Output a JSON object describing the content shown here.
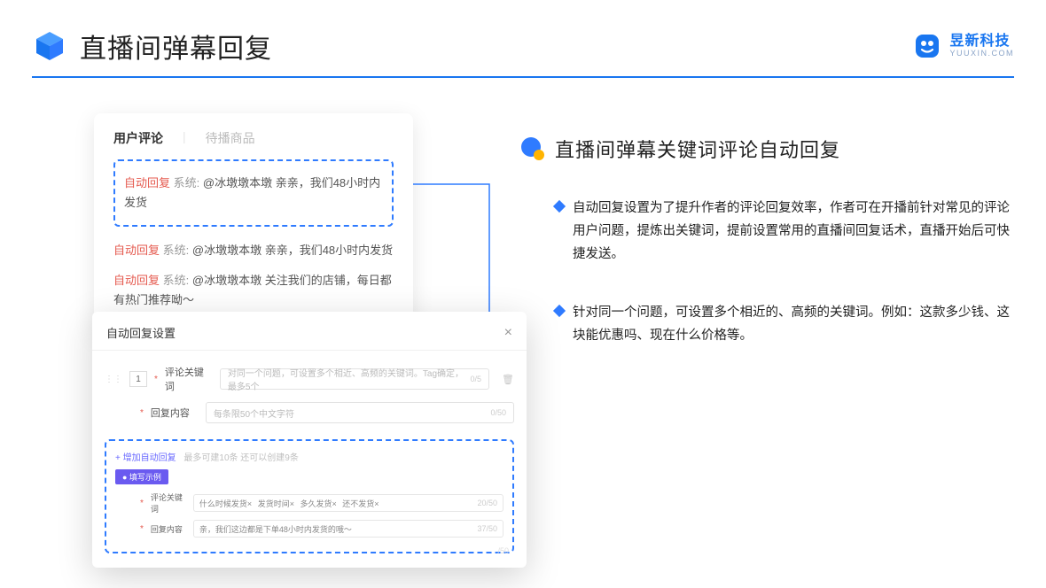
{
  "header": {
    "title": "直播间弹幕回复",
    "brand_cn": "昱新科技",
    "brand_en": "YUUXIN.COM"
  },
  "comments": {
    "tab_active": "用户评论",
    "tab_inactive": "待播商品",
    "rows": [
      {
        "tag": "自动回复",
        "sys": "系统:",
        "text": "@冰墩墩本墩 亲亲，我们48小时内发货"
      },
      {
        "tag": "自动回复",
        "sys": "系统:",
        "text": "@冰墩墩本墩 亲亲，我们48小时内发货"
      },
      {
        "tag": "自动回复",
        "sys": "系统:",
        "text": "@冰墩墩本墩 关注我们的店铺，每日都有热门推荐呦～"
      }
    ]
  },
  "modal": {
    "title": "自动回复设置",
    "index": "1",
    "keyword_label": "评论关键词",
    "keyword_placeholder": "对同一个问题，可设置多个相近、高频的关键词。Tag确定，最多5个",
    "keyword_count": "0/5",
    "content_label": "回复内容",
    "content_placeholder": "每条限50个中文字符",
    "content_count": "0/50",
    "add_link": "+ 增加自动回复",
    "add_hint": "最多可建10条 还可以创建9条",
    "example_badge": "● 填写示例",
    "ex_keyword_label": "评论关键词",
    "ex_tags": [
      "什么时候发货×",
      "发货时间×",
      "多久发货×",
      "还不发货×"
    ],
    "ex_keyword_count": "20/50",
    "ex_content_label": "回复内容",
    "ex_content_value": "亲，我们这边都是下单48小时内发货的哦～",
    "ex_content_count": "37/50",
    "stray_count": "/50"
  },
  "right": {
    "title": "直播间弹幕关键词评论自动回复",
    "bullets": [
      "自动回复设置为了提升作者的评论回复效率，作者可在开播前针对常见的评论用户问题，提炼出关键词，提前设置常用的直播间回复话术，直播开始后可快捷发送。",
      "针对同一个问题，可设置多个相近的、高频的关键词。例如：这款多少钱、这块能优惠吗、现在什么价格等。"
    ]
  }
}
